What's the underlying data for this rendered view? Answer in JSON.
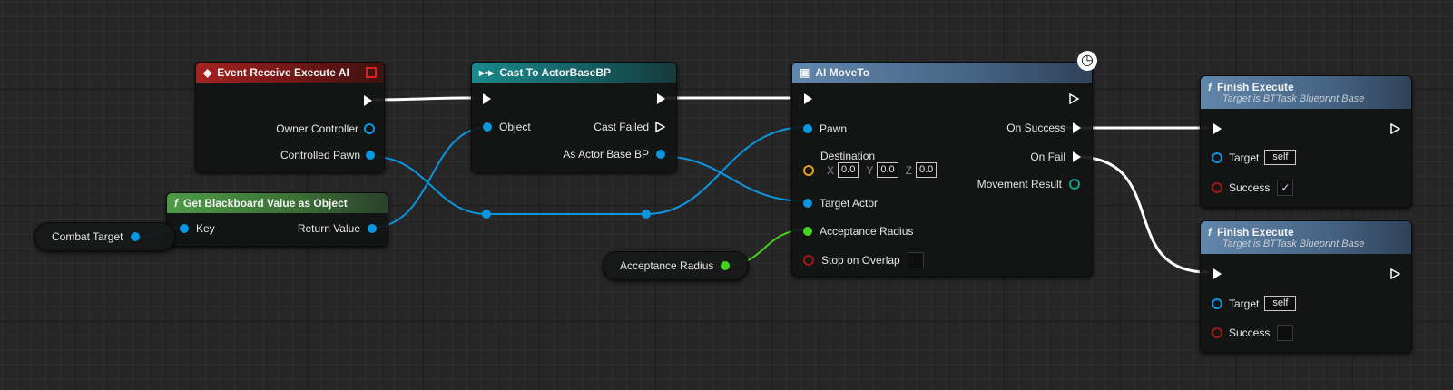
{
  "event_node": {
    "title": "Event Receive Execute AI",
    "pins": [
      "Owner Controller",
      "Controlled Pawn"
    ]
  },
  "cast_node": {
    "title": "Cast To ActorBaseBP",
    "in_pin": "Object",
    "out_pins": [
      "Cast Failed",
      "As Actor Base BP"
    ]
  },
  "blackboard_node": {
    "title": "Get Blackboard Value as Object",
    "in_pin": "Key",
    "out_pin": "Return Value"
  },
  "combat_target_var": {
    "label": "Combat Target"
  },
  "acceptance_radius_var": {
    "label": "Acceptance Radius"
  },
  "moveto_node": {
    "title": "AI MoveTo",
    "pins": {
      "pawn": "Pawn",
      "destination": "Destination",
      "target_actor": "Target Actor",
      "acceptance_radius": "Acceptance Radius",
      "stop_on_overlap": "Stop on Overlap"
    },
    "outputs": {
      "on_success": "On Success",
      "on_fail": "On Fail",
      "movement_result": "Movement Result"
    },
    "destination": {
      "x_label": "X",
      "x": "0.0",
      "y_label": "Y",
      "y": "0.0",
      "z_label": "Z",
      "z": "0.0"
    },
    "latent_icon": "clock-icon"
  },
  "finish_nodes": [
    {
      "title": "Finish Execute",
      "subtitle": "Target is BTTask Blueprint Base",
      "target_label": "Target",
      "target_value": "self",
      "success_label": "Success",
      "success_checked": true,
      "check_mark": "✓"
    },
    {
      "title": "Finish Execute",
      "subtitle": "Target is BTTask Blueprint Base",
      "target_label": "Target",
      "target_value": "self",
      "success_label": "Success",
      "success_checked": false,
      "check_mark": ""
    }
  ],
  "colors": {
    "exec": "#ffffff",
    "object_pin": "#0a96e0",
    "float_pin": "#45d21f",
    "bool_pin": "#a31616",
    "vector_pin": "#e2a11c",
    "enum_pin": "#159c8c"
  }
}
